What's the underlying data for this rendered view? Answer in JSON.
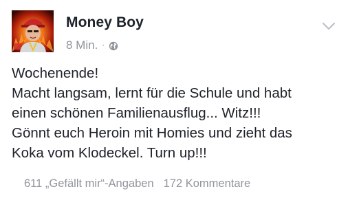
{
  "post": {
    "author": "Money Boy",
    "timestamp": "8 Min.",
    "separator": "·",
    "privacy_icon": "globe-icon",
    "menu_icon": "chevron-down-icon",
    "text_lines": [
      "Wochenende!",
      "Macht langsam, lernt für die Schule und habt",
      "einen schönen Familienausflug... Witz!!!",
      "Gönnt euch Heroin mit Homies und zieht das",
      "Koka vom Klodeckel. Turn up!!!"
    ],
    "likes": "611 „Gefällt mir“-Angaben",
    "comments": "172 Kommentare"
  },
  "colors": {
    "text": "#1d2129",
    "muted": "#90949c",
    "background": "#ffffff"
  }
}
